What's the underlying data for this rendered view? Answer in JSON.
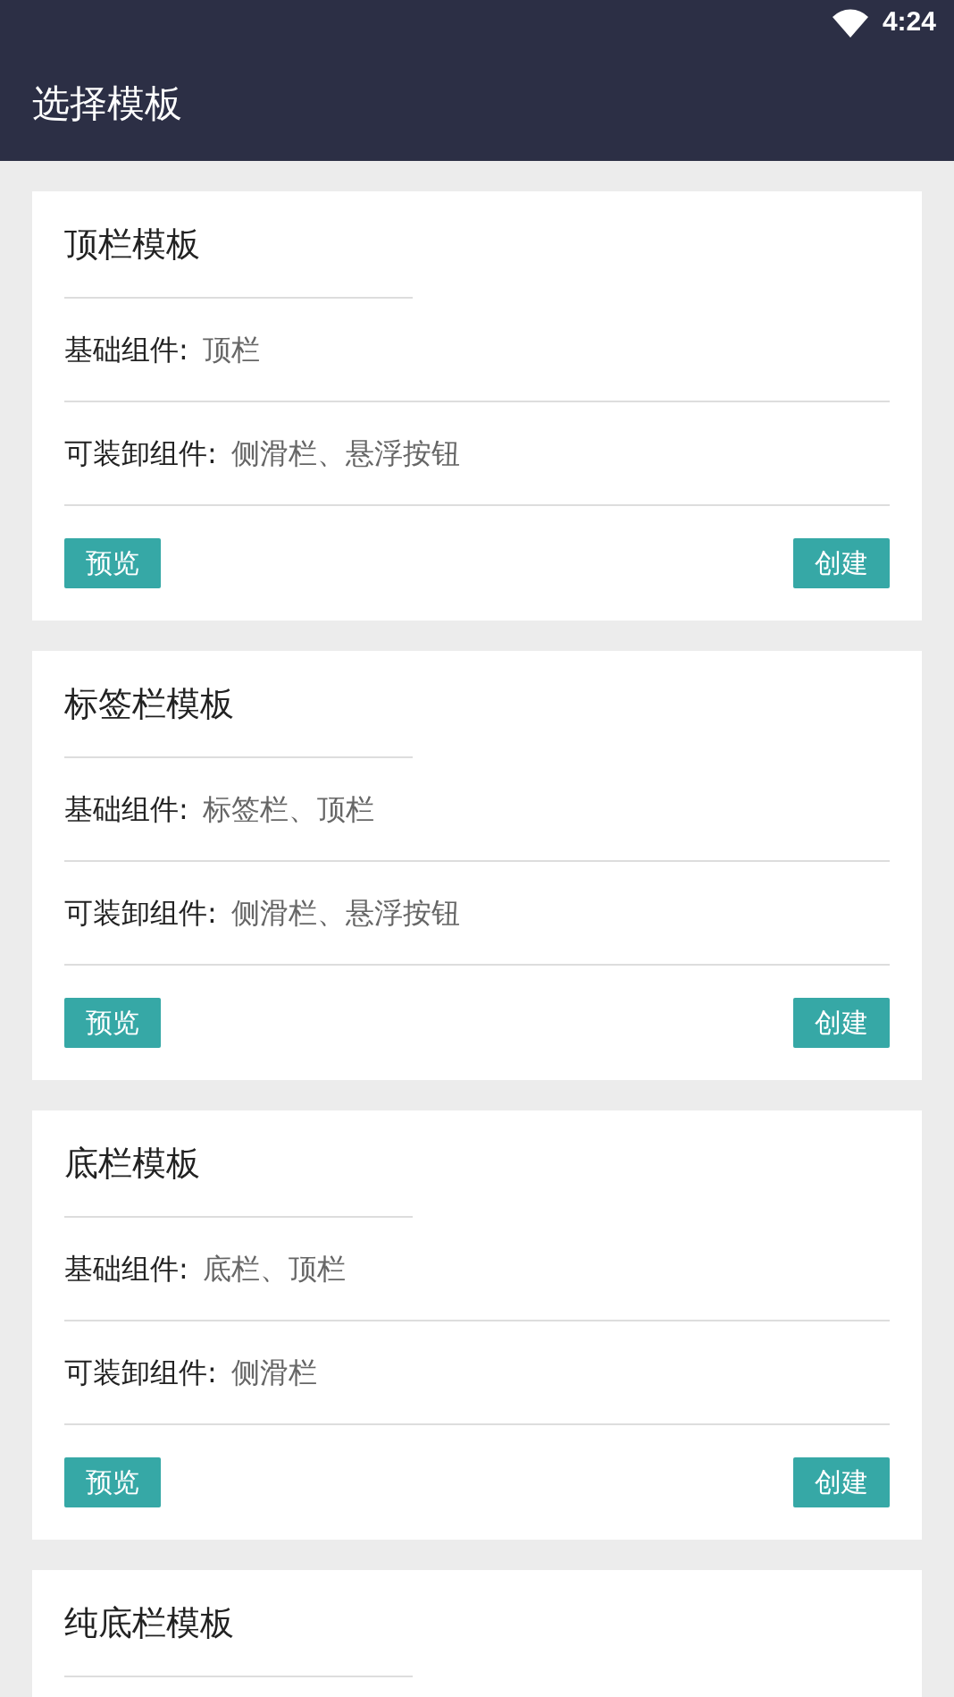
{
  "status_bar": {
    "time": "4:24"
  },
  "app_bar": {
    "title": "选择模板"
  },
  "cards": [
    {
      "title": "顶栏模板",
      "rows": [
        {
          "label": "基础组件:",
          "value": "顶栏"
        },
        {
          "label": "可装卸组件:",
          "value": "侧滑栏、悬浮按钮"
        }
      ],
      "buttons": [
        "预览",
        "创建"
      ]
    },
    {
      "title": "标签栏模板",
      "rows": [
        {
          "label": "基础组件:",
          "value": "标签栏、顶栏"
        },
        {
          "label": "可装卸组件:",
          "value": "侧滑栏、悬浮按钮"
        }
      ],
      "buttons": [
        "预览",
        "创建"
      ]
    },
    {
      "title": "底栏模板",
      "rows": [
        {
          "label": "基础组件:",
          "value": "底栏、顶栏"
        },
        {
          "label": "可装卸组件:",
          "value": "侧滑栏"
        }
      ],
      "buttons": [
        "预览",
        "创建"
      ]
    },
    {
      "title": "纯底栏模板"
    }
  ]
}
